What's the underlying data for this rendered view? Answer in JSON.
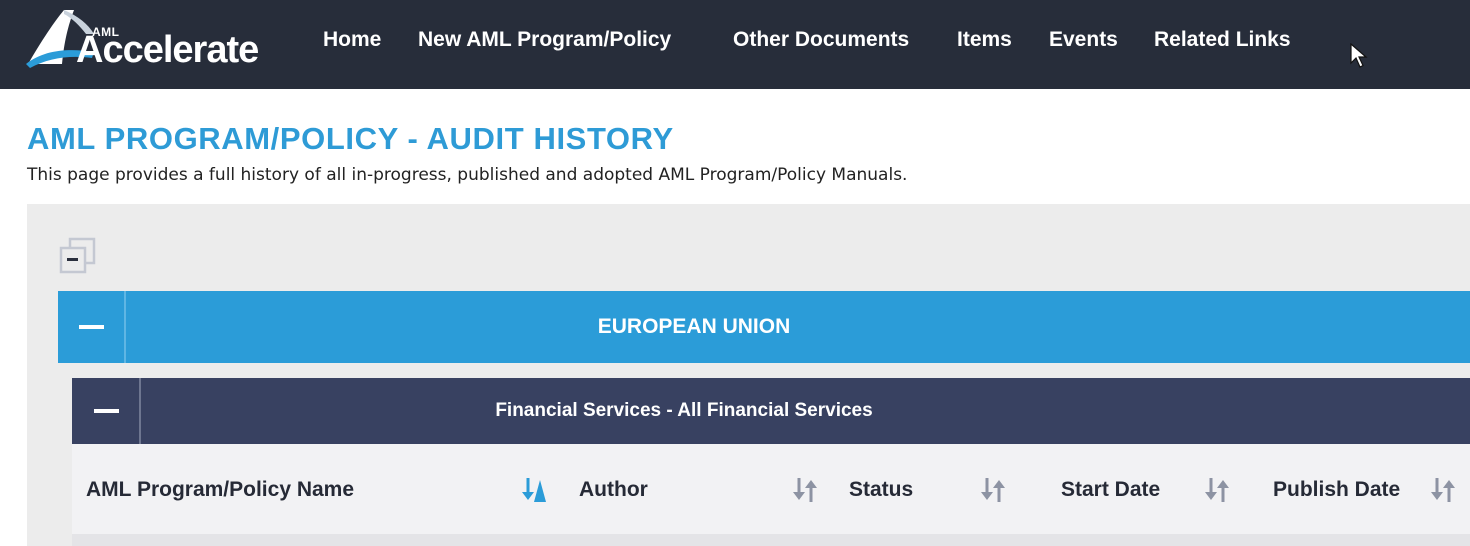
{
  "brand": {
    "prefix": "AML",
    "name": "Accelerate"
  },
  "nav": {
    "items": [
      "Home",
      "New AML Program/Policy",
      "Other Documents",
      "Items",
      "Events",
      "Related Links"
    ]
  },
  "page": {
    "title": "AML PROGRAM/POLICY - AUDIT HISTORY",
    "description": "This page provides a full history of all in-progress, published and adopted AML Program/Policy Manuals."
  },
  "groups": {
    "region": "EUROPEAN UNION",
    "category": "Financial Services - All Financial Services"
  },
  "table": {
    "columns": [
      {
        "label": "AML Program/Policy Name",
        "sort_icon": "sort-descending-active-icon"
      },
      {
        "label": "Author",
        "sort_icon": "sort-icon"
      },
      {
        "label": "Status",
        "sort_icon": "sort-icon"
      },
      {
        "label": "Start Date",
        "sort_icon": "sort-icon"
      },
      {
        "label": "Publish Date",
        "sort_icon": "sort-icon"
      }
    ]
  },
  "colors": {
    "nav_bg": "#272d3a",
    "accent_blue": "#2b9cd8",
    "group_navy": "#384161",
    "sort_active": "#2b9cd8",
    "sort_inactive": "#8d93a3"
  }
}
